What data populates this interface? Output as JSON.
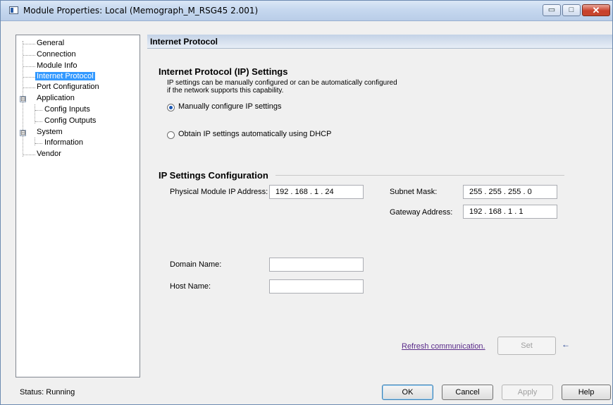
{
  "window": {
    "title": "Module Properties: Local (Memograph_M_RSG45 2.001)",
    "minimize_glyph": "▭",
    "maximize_glyph": "□",
    "close_glyph": "✕"
  },
  "tree": {
    "items": [
      {
        "label": "General"
      },
      {
        "label": "Connection"
      },
      {
        "label": "Module Info"
      },
      {
        "label": "Internet Protocol",
        "selected": true
      },
      {
        "label": "Port Configuration"
      },
      {
        "label": "Application",
        "expander": "⊟"
      },
      {
        "label": "Config Inputs"
      },
      {
        "label": "Config Outputs"
      },
      {
        "label": "System",
        "expander": "⊟"
      },
      {
        "label": "Information"
      },
      {
        "label": "Vendor"
      }
    ]
  },
  "section": {
    "title": "Internet Protocol"
  },
  "ip_settings": {
    "heading": "Internet Protocol (IP) Settings",
    "desc_line1": "IP settings can be manually configured or can be automatically configured",
    "desc_line2": "if the network supports this capability.",
    "manual_label": "Manually configure IP settings",
    "dhcp_label": "Obtain IP settings automatically using DHCP",
    "manual_selected": true
  },
  "ip_config": {
    "heading": "IP Settings Configuration",
    "physical_label": "Physical Module IP Address:",
    "physical_value": "192 . 168 .  1  .  24",
    "subnet_label": "Subnet Mask:",
    "subnet_value": "255 . 255 . 255 .  0",
    "gateway_label": "Gateway Address:",
    "gateway_value": "192 . 168 .  1  .  1",
    "domain_label": "Domain Name:",
    "domain_value": "",
    "host_label": "Host Name:",
    "host_value": ""
  },
  "actions": {
    "refresh_link": "Refresh communication.",
    "set_label": "Set",
    "arrow_glyph": "←"
  },
  "footer": {
    "status": "Status:  Running",
    "ok": "OK",
    "cancel": "Cancel",
    "apply": "Apply",
    "help": "Help"
  }
}
